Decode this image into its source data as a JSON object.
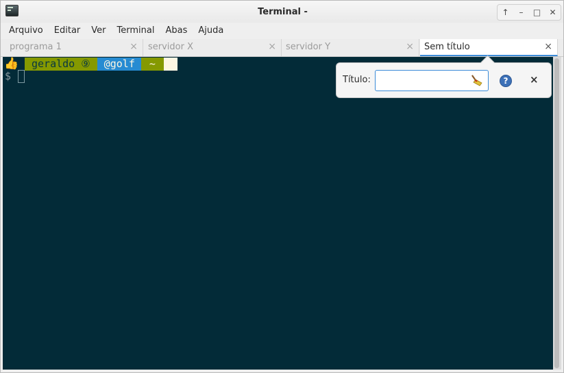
{
  "window": {
    "title": "Terminal -"
  },
  "window_buttons": {
    "keep_above": "↑",
    "minimize": "–",
    "maximize": "□",
    "close": "✕"
  },
  "menu": [
    {
      "label": "Arquivo"
    },
    {
      "label": "Editar"
    },
    {
      "label": "Ver"
    },
    {
      "label": "Terminal"
    },
    {
      "label": "Abas"
    },
    {
      "label": "Ajuda"
    }
  ],
  "tabs": [
    {
      "label": "programa 1",
      "close": "×"
    },
    {
      "label": "servidor X",
      "close": "×"
    },
    {
      "label": "servidor Y",
      "close": "×"
    },
    {
      "label": "Sem título",
      "close": "×"
    }
  ],
  "terminal": {
    "prompt": {
      "thumb": "👍",
      "user": "geraldo ⑨",
      "host": "@golf",
      "dir": "~"
    },
    "shell_prompt": "$"
  },
  "rename_popover": {
    "label": "Título:",
    "input_value": "",
    "help_glyph": "?",
    "close_glyph": "×"
  },
  "colors": {
    "terminal_bg": "#032b38",
    "segment_green": "#859900",
    "segment_blue": "#268bd2",
    "active_tab_underline": "#3b8bd8"
  }
}
